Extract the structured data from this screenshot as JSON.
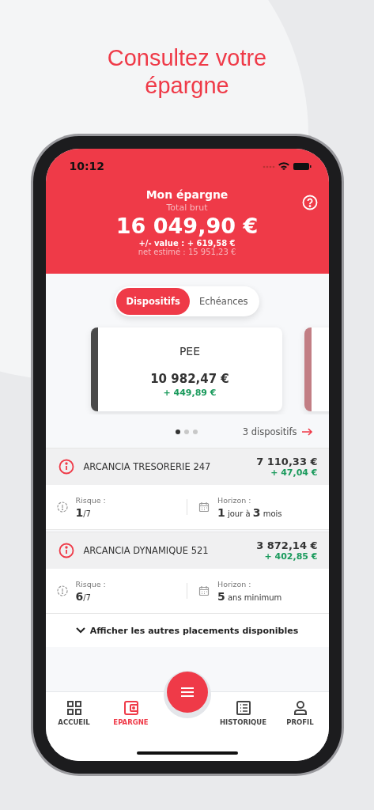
{
  "headline": "Consultez votre épargne",
  "status_bar": {
    "time": "10:12"
  },
  "header": {
    "title": "Mon épargne",
    "subtitle": "Total brut",
    "total": "16 049,90 €",
    "plus_minus": "+/- value : + 619,58 €",
    "net": "net estimé : 15 951,23 €"
  },
  "tabs": [
    {
      "label": "Dispositifs",
      "selected": true
    },
    {
      "label": "Echéances",
      "selected": false
    }
  ],
  "cards": [
    {
      "title": "PEE",
      "amount": "10 982,47 €",
      "gain": "+ 449,89 €",
      "color": "#4a4a4a"
    },
    {
      "color": "#c27e84"
    }
  ],
  "pager": [
    {
      "selected": true
    },
    {
      "selected": false
    },
    {
      "selected": false
    }
  ],
  "devices_link": "3 dispositifs",
  "funds": [
    {
      "name": "ARCANCIA TRESORERIE 247",
      "amount": "7 110,33 €",
      "gain": "+ 47,04 €",
      "risk_label": "Risque :",
      "risk": "**1**/7",
      "horizon_label": "Horizon :",
      "horizon": "**1** jour à **3** mois"
    },
    {
      "name": "ARCANCIA DYNAMIQUE 521",
      "amount": "3 872,14 €",
      "gain": "+ 402,85 €",
      "risk_label": "Risque :",
      "risk": "**6**/7",
      "horizon_label": "Horizon :",
      "horizon": "**5** ans minimum"
    }
  ],
  "show_more": "Afficher les autres placements disponibles",
  "nav": [
    {
      "label": "ACCUEIL",
      "kind": "grid",
      "selected": false
    },
    {
      "label": "EPARGNE",
      "kind": "wallet",
      "selected": true
    },
    {
      "label": "HISTORIQUE",
      "kind": "list",
      "selected": false
    },
    {
      "label": "PROFIL",
      "kind": "user",
      "selected": false
    }
  ]
}
